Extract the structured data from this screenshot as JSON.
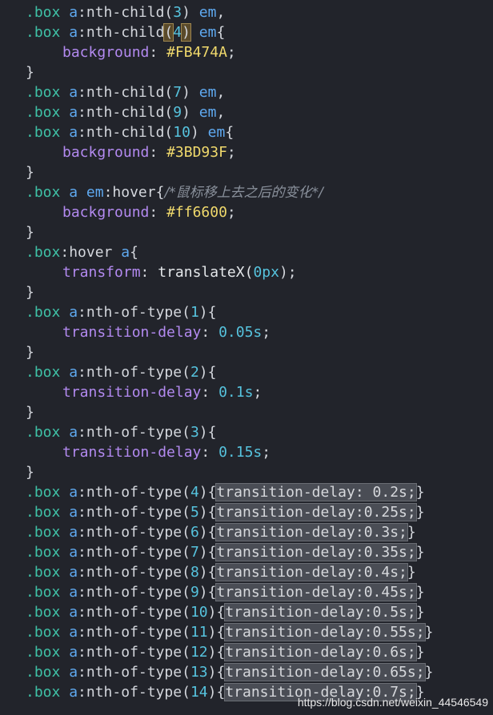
{
  "code": {
    "l1": {
      "sel": ".box",
      "tag": "a",
      "pseudo": ":nth-child(",
      "num": "3",
      "close": ")",
      "em": "em",
      "end": ","
    },
    "l2": {
      "sel": ".box",
      "tag": "a",
      "pseudo": ":nth-child",
      "open": "(",
      "num": "4",
      "close": ")",
      "em": "em",
      "end": "{"
    },
    "l3": {
      "prop": "background",
      "colon": ":",
      "value": "#FB474A",
      "semi": ";"
    },
    "l4": {
      "brace": "}"
    },
    "l5": {
      "sel": ".box",
      "tag": "a",
      "pseudo": ":nth-child(",
      "num": "7",
      "close": ")",
      "em": "em",
      "end": ","
    },
    "l6": {
      "sel": ".box",
      "tag": "a",
      "pseudo": ":nth-child(",
      "num": "9",
      "close": ")",
      "em": "em",
      "end": ","
    },
    "l7": {
      "sel": ".box",
      "tag": "a",
      "pseudo": ":nth-child(",
      "num": "10",
      "close": ")",
      "em": "em",
      "end": "{"
    },
    "l8": {
      "prop": "background",
      "colon": ":",
      "value": "#3BD93F",
      "semi": ";"
    },
    "l9": {
      "brace": "}"
    },
    "l10": {
      "sel": ".box",
      "tag": "a",
      "em": "em",
      "pseudo": ":hover{",
      "comment": "/*鼠标移上去之后的变化*/"
    },
    "l11": {
      "prop": "background",
      "colon": ":",
      "value": "#ff6600",
      "semi": ";"
    },
    "l12": {
      "brace": "}"
    },
    "l13": {
      "sel": ".box",
      "pseudo": ":hover",
      "tag": "a",
      "end": "{"
    },
    "l14": {
      "prop": "transform",
      "colon": ":",
      "fn": "translateX(",
      "num": "0px",
      "close": ");"
    },
    "l15": {
      "brace": "}"
    },
    "l16": {
      "sel": ".box",
      "tag": "a",
      "pseudo": ":nth-of-type(",
      "num": "1",
      "end": "){"
    },
    "l17": {
      "prop": "transition-delay",
      "colon": ":",
      "num": "0.05s",
      "semi": ";"
    },
    "l18": {
      "brace": "}"
    },
    "l19": {
      "sel": ".box",
      "tag": "a",
      "pseudo": ":nth-of-type(",
      "num": "2",
      "end": "){"
    },
    "l20": {
      "prop": "transition-delay",
      "colon": ":",
      "num": "0.1s",
      "semi": ";"
    },
    "l21": {
      "brace": "}"
    },
    "l22": {
      "sel": ".box",
      "tag": "a",
      "pseudo": ":nth-of-type(",
      "num": "3",
      "end": "){"
    },
    "l23": {
      "prop": "transition-delay",
      "colon": ":",
      "num": "0.15s",
      "semi": ";"
    },
    "l24": {
      "brace": "}"
    },
    "folded": [
      {
        "sel": ".box",
        "tag": "a",
        "pseudo": ":nth-of-type(",
        "num": "4",
        "open": "){",
        "box": "transition-delay: 0.2s;",
        "close": "}"
      },
      {
        "sel": ".box",
        "tag": "a",
        "pseudo": ":nth-of-type(",
        "num": "5",
        "open": "){",
        "box": "transition-delay:0.25s;",
        "close": "}"
      },
      {
        "sel": ".box",
        "tag": "a",
        "pseudo": ":nth-of-type(",
        "num": "6",
        "open": "){",
        "box": "transition-delay:0.3s;",
        "close": "}"
      },
      {
        "sel": ".box",
        "tag": "a",
        "pseudo": ":nth-of-type(",
        "num": "7",
        "open": "){",
        "box": "transition-delay:0.35s;",
        "close": "}"
      },
      {
        "sel": ".box",
        "tag": "a",
        "pseudo": ":nth-of-type(",
        "num": "8",
        "open": "){",
        "box": "transition-delay:0.4s;",
        "close": "}"
      },
      {
        "sel": ".box",
        "tag": "a",
        "pseudo": ":nth-of-type(",
        "num": "9",
        "open": "){",
        "box": "transition-delay:0.45s;",
        "close": "}"
      },
      {
        "sel": ".box",
        "tag": "a",
        "pseudo": ":nth-of-type(",
        "num": "10",
        "open": "){",
        "box": "transition-delay:0.5s;",
        "close": "}"
      },
      {
        "sel": ".box",
        "tag": "a",
        "pseudo": ":nth-of-type(",
        "num": "11",
        "open": "){",
        "box": "transition-delay:0.55s;",
        "close": "}"
      },
      {
        "sel": ".box",
        "tag": "a",
        "pseudo": ":nth-of-type(",
        "num": "12",
        "open": "){",
        "box": "transition-delay:0.6s;",
        "close": "}"
      },
      {
        "sel": ".box",
        "tag": "a",
        "pseudo": ":nth-of-type(",
        "num": "13",
        "open": "){",
        "box": "transition-delay:0.65s;",
        "close": "}"
      },
      {
        "sel": ".box",
        "tag": "a",
        "pseudo": ":nth-of-type(",
        "num": "14",
        "open": "){",
        "box": "transition-delay:0.7s;",
        "close": "}"
      }
    ]
  },
  "watermark": "https://blog.csdn.net/weixin_44546549"
}
